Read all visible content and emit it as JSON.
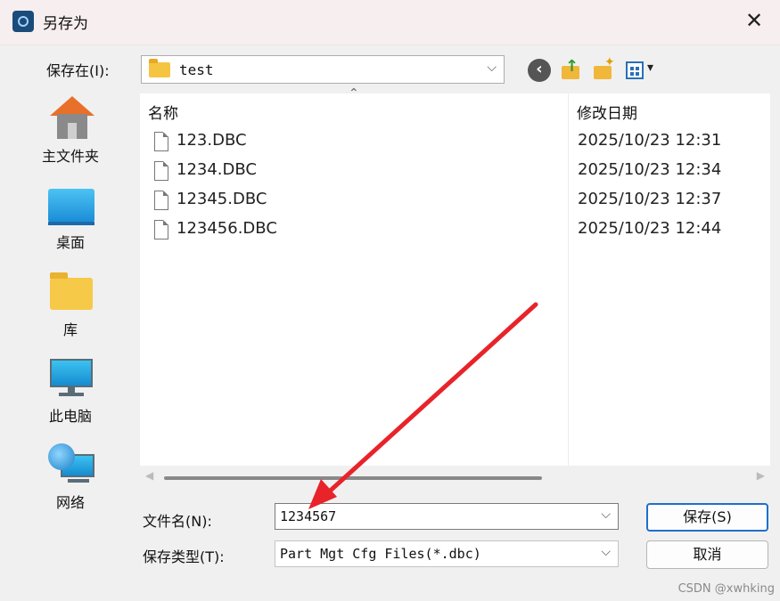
{
  "window": {
    "title": "另存为",
    "icon": "app-icon",
    "close_glyph": "✕"
  },
  "toolbar": {
    "save_in_label": "保存在(I):",
    "save_in_value": "test",
    "back_icon": "back-icon",
    "up_icon": "up-folder-icon",
    "new_folder_icon": "new-folder-icon",
    "view_menu_icon": "view-menu-icon"
  },
  "places": [
    {
      "label": "主文件夹",
      "icon": "home-icon"
    },
    {
      "label": "桌面",
      "icon": "desktop-icon"
    },
    {
      "label": "库",
      "icon": "library-icon"
    },
    {
      "label": "此电脑",
      "icon": "computer-icon"
    },
    {
      "label": "网络",
      "icon": "network-icon"
    }
  ],
  "file_list": {
    "columns": {
      "name": "名称",
      "date": "修改日期"
    },
    "rows": [
      {
        "name": "123.DBC",
        "date": "2025/10/23 12:31"
      },
      {
        "name": "1234.DBC",
        "date": "2025/10/23 12:34"
      },
      {
        "name": "12345.DBC",
        "date": "2025/10/23 12:37"
      },
      {
        "name": "123456.DBC",
        "date": "2025/10/23 12:44"
      }
    ]
  },
  "form": {
    "filename_label": "文件名(N):",
    "filename_value": "1234567",
    "filetype_label": "保存类型(T):",
    "filetype_value": "Part Mgt Cfg Files(*.dbc)",
    "save_button": "保存(S)",
    "cancel_button": "取消"
  },
  "annotation": {
    "color": "#e8232a"
  },
  "watermark": "CSDN @xwhking"
}
